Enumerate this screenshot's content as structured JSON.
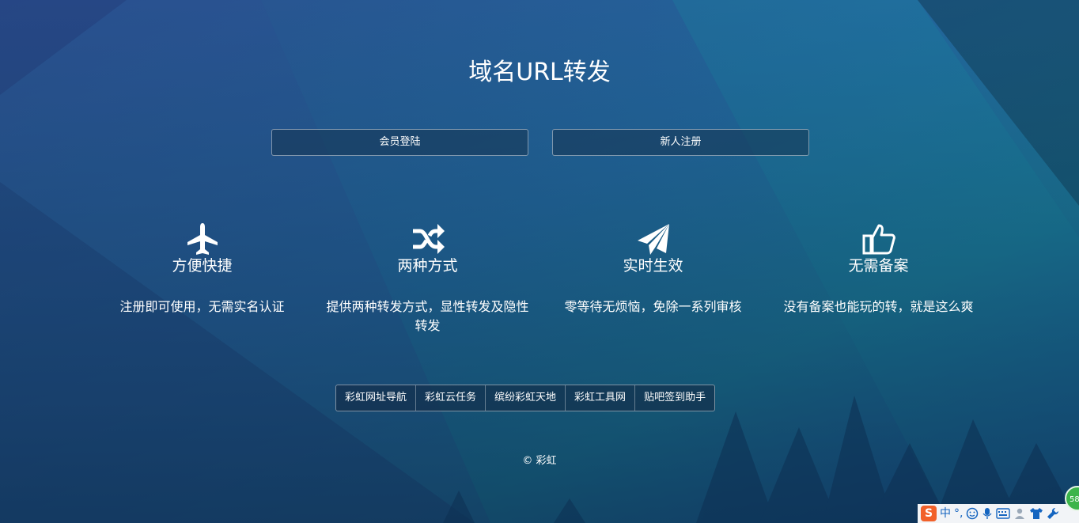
{
  "page": {
    "title": "域名URL转发"
  },
  "buttons": {
    "login": "会员登陆",
    "register": "新人注册"
  },
  "features": [
    {
      "icon": "airplane-icon",
      "title": "方便快捷",
      "desc": "注册即可使用，无需实名认证"
    },
    {
      "icon": "shuffle-icon",
      "title": "两种方式",
      "desc": "提供两种转发方式，显性转发及隐性转发"
    },
    {
      "icon": "paper-plane-icon",
      "title": "实时生效",
      "desc": "零等待无烦恼，免除一系列审核"
    },
    {
      "icon": "thumbs-up-icon",
      "title": "无需备案",
      "desc": "没有备案也能玩的转，就是这么爽"
    }
  ],
  "links": [
    "彩虹网址导航",
    "彩虹云任务",
    "缤纷彩虹天地",
    "彩虹工具网",
    "贴吧签到助手"
  ],
  "footer": {
    "copyright": "© 彩虹"
  },
  "ime": {
    "logo": "S",
    "mode": "中",
    "punct": "°,",
    "badge": "58"
  },
  "colors": {
    "background": "#1f4f86",
    "ime_logo": "#f2612a",
    "badge": "#3cb44a"
  }
}
